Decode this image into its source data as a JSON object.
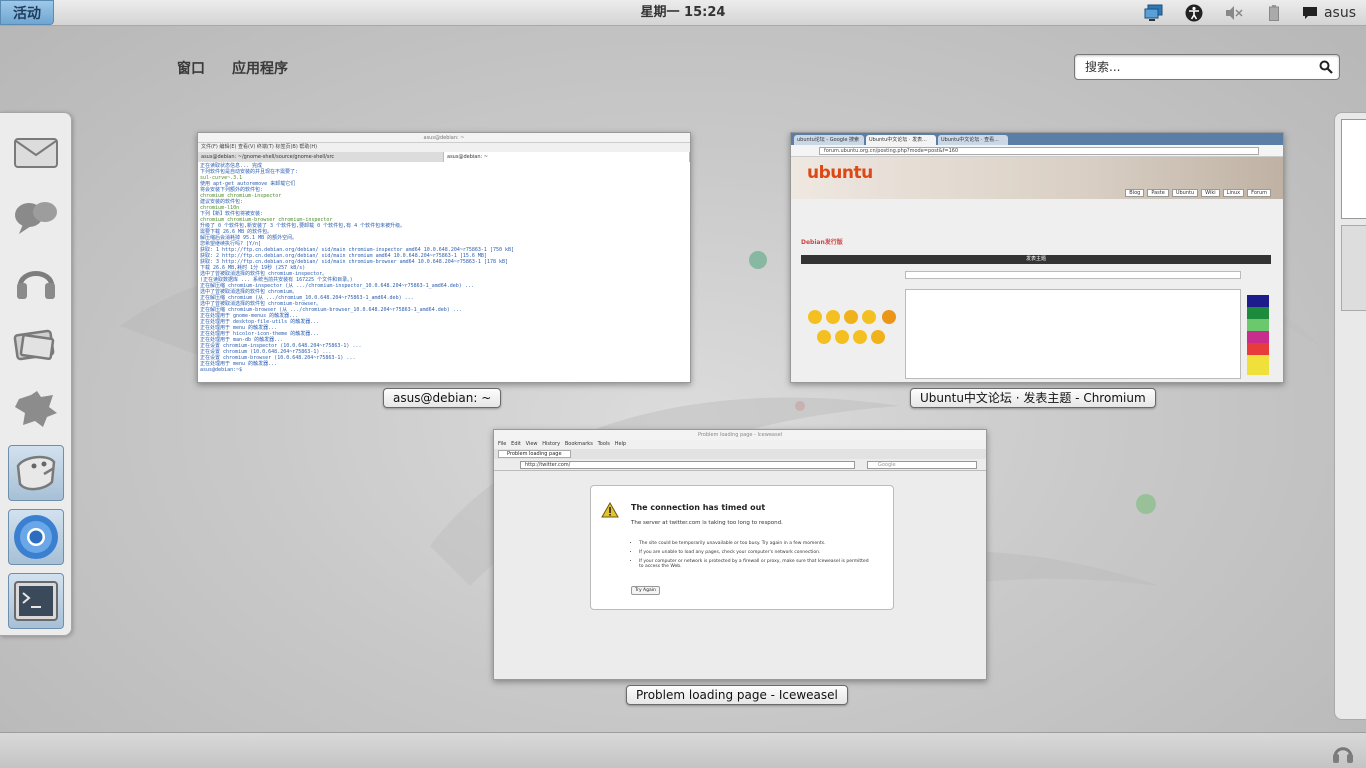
{
  "topbar": {
    "activities": "活动",
    "clock": "星期一 15:24",
    "user": "asus",
    "tray_icons": [
      "display-icon",
      "accessibility-icon",
      "volume-muted-icon",
      "battery-icon"
    ]
  },
  "overview": {
    "tabs": [
      "窗口",
      "应用程序"
    ],
    "search_placeholder": "搜索..."
  },
  "dash": {
    "items": [
      {
        "name": "mail-icon",
        "running": false
      },
      {
        "name": "empathy-icon",
        "running": false
      },
      {
        "name": "rhythmbox-icon",
        "running": false
      },
      {
        "name": "shotwell-icon",
        "running": false
      },
      {
        "name": "settings-icon",
        "running": false
      },
      {
        "name": "file-roller-icon",
        "running": true
      },
      {
        "name": "chromium-icon",
        "running": true
      },
      {
        "name": "terminal-icon",
        "running": true
      }
    ]
  },
  "windows": {
    "terminal": {
      "label": "asus@debian: ~",
      "title": "asus@debian: ~",
      "menu": "文件(F)  编辑(E)  查看(V)  终端(T)  标签页(B)  帮助(H)",
      "tabs": [
        "asus@debian: ~/gnome-shell/source/gnome-shell/src",
        "asus@debian: ~"
      ],
      "lines": [
        "正在读取状态信息... 完成",
        "下列软件包是自动安装的并且现在不需要了:",
        "  sul-curve~.3.1",
        "使用 apt-get autoremove 来卸载它们",
        "将会安装下列额外的软件包:",
        "  chromium chromium-inspector",
        "建议安装的软件包:",
        "  chromium-l10n",
        "下列【新】软件包将被安装:",
        "  chromium chromium-browser chromium-inspector",
        "升级了 0 个软件包,新安装了 3 个软件包,要卸载 0 个软件包,有 4 个软件包未被升级。",
        "需要下载 26.6 MB 的软件包。",
        "解压缩后会消耗掉 95.1 MB 的额外空间。",
        "您希望继续执行吗? [Y/n]",
        "获取: 1 http://ftp.cn.debian.org/debian/ sid/main chromium-inspector amd64 10.0.648.204~r75863-1 [750 kB]",
        "获取: 2 http://ftp.cn.debian.org/debian/ sid/main chromium amd64 10.0.648.204~r75863-1 [15.6 MB]",
        "获取: 3 http://ftp.cn.debian.org/debian/ sid/main chromium-browser amd64 10.0.648.204~r75863-1 [178 kB]",
        "下载 26.6 MB,耗时 1分 19秒 (257 kB/s)",
        "选中了曾被取消选择的软件包 chromium-inspector。",
        "(正在读取数据库 ... 系统当前共安装有 167225 个文件和目录。)",
        "正在解压缩 chromium-inspector (从 .../chromium-inspector_10.0.648.204~r75863-1_amd64.deb) ...",
        "选中了曾被取消选择的软件包 chromium。",
        "正在解压缩 chromium (从 .../chromium_10.0.648.204~r75863-1_amd64.deb) ...",
        "选中了曾被取消选择的软件包 chromium-browser。",
        "正在解压缩 chromium-browser (从 .../chromium-browser_10.0.648.204~r75863-1_amd64.deb) ...",
        "正在处理用于 gnome-menus 的触发器...",
        "正在处理用于 desktop-file-utils 的触发器...",
        "正在处理用于 menu 的触发器...",
        "正在处理用于 hicolor-icon-theme 的触发器...",
        "正在处理用于 man-db 的触发器...",
        "正在设置 chromium-inspector (10.0.648.204~r75863-1) ...",
        "正在设置 chromium (10.0.648.204~r75863-1) ...",
        "正在设置 chromium-browser (10.0.648.204~r75863-1) ...",
        "正在处理用于 menu 的触发器...",
        "asus@debian:~$"
      ]
    },
    "chromium": {
      "label": "Ubuntu中文论坛 · 发表主题 - Chromium",
      "tabs": [
        "ubuntu论坛 - Google 搜索",
        "Ubuntu中文论坛 · 发表...",
        "Ubuntu中文论坛 · 查看..."
      ],
      "url": "forum.ubuntu.org.cn/posting.php?mode=post&f=160",
      "logo": "ubuntu",
      "nav": [
        "Blog",
        "Paste",
        "Ubuntu",
        "Wiki",
        "Linux",
        "Forum"
      ],
      "heading": "Debian发行版",
      "section": "发表主题"
    },
    "iceweasel": {
      "label": "Problem loading page - Iceweasel",
      "title": "Problem loading page - Iceweasel",
      "menu": [
        "File",
        "Edit",
        "View",
        "History",
        "Bookmarks",
        "Tools",
        "Help"
      ],
      "tab": "Problem loading page",
      "url": "http://twitter.com/",
      "search_placeholder": "Google",
      "error_title": "The connection has timed out",
      "error_sub": "The server at twitter.com is taking too long to respond.",
      "bullets": [
        "The site could be temporarily unavailable or too busy. Try again in a few moments.",
        "If you are unable to load any pages, check your computer's network connection.",
        "If your computer or network is protected by a firewall or proxy, make sure that Iceweasel is permitted to access the Web."
      ],
      "button": "Try Again"
    }
  }
}
